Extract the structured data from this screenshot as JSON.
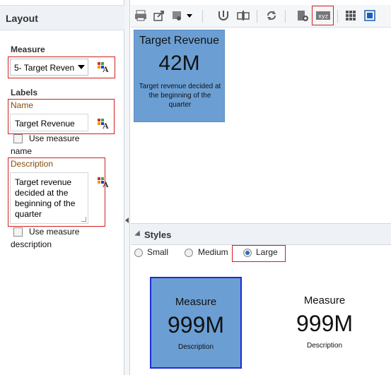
{
  "layout_panel": {
    "title": "Layout",
    "measure": {
      "label": "Measure",
      "selected": "5- Target Reven"
    },
    "labels": {
      "label": "Labels",
      "name": {
        "label": "Name",
        "value": "Target Revenue"
      },
      "use_measure_name": {
        "label_line1": "Use measure",
        "label_line2": "name",
        "checked": false
      },
      "description": {
        "label": "Description",
        "lines": [
          "Target revenue",
          "decided at the",
          "beginning of the",
          "quarter"
        ]
      },
      "use_measure_description": {
        "label_line1": "Use measure",
        "label_line2": "description",
        "checked": false
      }
    }
  },
  "toolbar": {
    "buttons": [
      "print-icon",
      "export-icon",
      "view-options-icon",
      "connect-icon",
      "chart-type-icon",
      "refresh-icon",
      "properties-icon",
      "xyz-icon",
      "grid-icon",
      "layout-icon"
    ],
    "xyz_label": "xyz"
  },
  "tile": {
    "title": "Target Revenue",
    "value": "42M",
    "description": "Target revenue decided at the beginning of the quarter",
    "color": "#6b9fd4"
  },
  "styles": {
    "title": "Styles",
    "options": [
      "Small",
      "Medium",
      "Large"
    ],
    "selected": "Large",
    "previews": [
      {
        "title": "Measure",
        "value": "999M",
        "description": "Description",
        "selected": true
      },
      {
        "title": "Measure",
        "value": "999M",
        "description": "Description",
        "selected": false
      }
    ]
  },
  "colors": {
    "accent": "#6b9fd4",
    "highlight_border": "#d02020",
    "selection_border": "#1f2bd8",
    "label_brown": "#8a4b08"
  }
}
